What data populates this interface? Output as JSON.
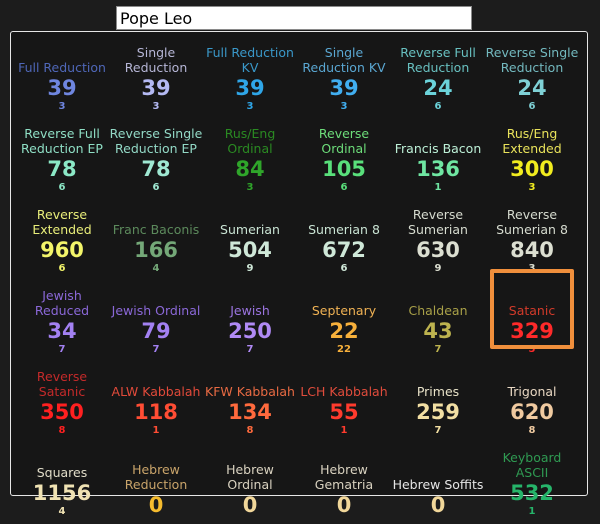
{
  "search": {
    "value": "Pope Leo"
  },
  "cells": [
    {
      "name": "Full Reduction",
      "value": "39",
      "reduced": "3",
      "name_color": "#4f67b8",
      "value_color": "#6f86e0",
      "reduced_color": "#6f86e0"
    },
    {
      "name": "Single Reduction",
      "value": "39",
      "reduced": "3",
      "name_color": "#b6b6d6",
      "value_color": "#b4b9f2",
      "reduced_color": "#b4b9f2"
    },
    {
      "name": "Full Reduction KV",
      "value": "39",
      "reduced": "3",
      "name_color": "#3a98c9",
      "value_color": "#2fa6e8",
      "reduced_color": "#2fa6e8"
    },
    {
      "name": "Single Reduction KV",
      "value": "39",
      "reduced": "3",
      "name_color": "#5aa7d2",
      "value_color": "#41aef0",
      "reduced_color": "#41aef0"
    },
    {
      "name": "Reverse Full Reduction",
      "value": "24",
      "reduced": "6",
      "name_color": "#68c0c0",
      "value_color": "#6bd3da",
      "reduced_color": "#6bd3da"
    },
    {
      "name": "Reverse Single Reduction",
      "value": "24",
      "reduced": "6",
      "name_color": "#73b9bf",
      "value_color": "#7fd1d6",
      "reduced_color": "#7fd1d6"
    },
    {
      "name": "Reverse Full Reduction EP",
      "value": "78",
      "reduced": "6",
      "name_color": "#8fdfc5",
      "value_color": "#8be8c6",
      "reduced_color": "#8be8c6"
    },
    {
      "name": "Reverse Single Reduction EP",
      "value": "78",
      "reduced": "6",
      "name_color": "#93d9c6",
      "value_color": "#9fe8d2",
      "reduced_color": "#9fe8d2"
    },
    {
      "name": "Rus/Eng Ordinal",
      "value": "84",
      "reduced": "3",
      "name_color": "#2a8a22",
      "value_color": "#2fa52a",
      "reduced_color": "#2fa52a"
    },
    {
      "name": "Reverse Ordinal",
      "value": "105",
      "reduced": "6",
      "name_color": "#6ddd7a",
      "value_color": "#59e07b",
      "reduced_color": "#59e07b"
    },
    {
      "name": "Francis Bacon",
      "value": "136",
      "reduced": "1",
      "name_color": "#bdf0d7",
      "value_color": "#6fe6a2",
      "reduced_color": "#6fe6a2"
    },
    {
      "name": "Rus/Eng Extended",
      "value": "300",
      "reduced": "3",
      "name_color": "#e9e35b",
      "value_color": "#f1ec1f",
      "reduced_color": "#f1ec1f"
    },
    {
      "name": "Reverse Extended",
      "value": "960",
      "reduced": "6",
      "name_color": "#e9ee7a",
      "value_color": "#f3f56a",
      "reduced_color": "#f3f56a"
    },
    {
      "name": "Franc Baconis",
      "value": "166",
      "reduced": "4",
      "name_color": "#5c8a5c",
      "value_color": "#74a878",
      "reduced_color": "#74a878"
    },
    {
      "name": "Sumerian",
      "value": "504",
      "reduced": "9",
      "name_color": "#c9e3d3",
      "value_color": "#cfe8d8",
      "reduced_color": "#cfe8d8"
    },
    {
      "name": "Sumerian 8",
      "value": "672",
      "reduced": "6",
      "name_color": "#c9e3d3",
      "value_color": "#cfe8d8",
      "reduced_color": "#cfe8d8"
    },
    {
      "name": "Reverse Sumerian",
      "value": "630",
      "reduced": "9",
      "name_color": "#d6dbcf",
      "value_color": "#dcdfd1",
      "reduced_color": "#dcdfd1"
    },
    {
      "name": "Reverse Sumerian 8",
      "value": "840",
      "reduced": "3",
      "name_color": "#d6dbcf",
      "value_color": "#dcdfd1",
      "reduced_color": "#dcdfd1"
    },
    {
      "name": "Jewish Reduced",
      "value": "34",
      "reduced": "7",
      "name_color": "#8b68d8",
      "value_color": "#a381f2",
      "reduced_color": "#a381f2"
    },
    {
      "name": "Jewish Ordinal",
      "value": "79",
      "reduced": "7",
      "name_color": "#8b68d8",
      "value_color": "#a381f2",
      "reduced_color": "#a381f2"
    },
    {
      "name": "Jewish",
      "value": "250",
      "reduced": "7",
      "name_color": "#9b74e0",
      "value_color": "#b08af5",
      "reduced_color": "#b08af5"
    },
    {
      "name": "Septenary",
      "value": "22",
      "reduced": "22",
      "name_color": "#f0b254",
      "value_color": "#f7b03b",
      "reduced_color": "#f7b03b"
    },
    {
      "name": "Chaldean",
      "value": "43",
      "reduced": "7",
      "name_color": "#a8a048",
      "value_color": "#bdb34f",
      "reduced_color": "#bdb34f"
    },
    {
      "name": "Satanic",
      "value": "329",
      "reduced": "5",
      "name_color": "#d23a2a",
      "value_color": "#ff2a2a",
      "reduced_color": "#ff2a2a"
    },
    {
      "name": "Reverse Satanic",
      "value": "350",
      "reduced": "8",
      "name_color": "#c42a2a",
      "value_color": "#ff2020",
      "reduced_color": "#ff2020"
    },
    {
      "name": "ALW Kabbalah",
      "value": "118",
      "reduced": "1",
      "name_color": "#e14a3a",
      "value_color": "#ff4d34",
      "reduced_color": "#ff4d34"
    },
    {
      "name": "KFW Kabbalah",
      "value": "134",
      "reduced": "8",
      "name_color": "#e86a43",
      "value_color": "#ff6a3d",
      "reduced_color": "#ff6a3d"
    },
    {
      "name": "LCH Kabbalah",
      "value": "55",
      "reduced": "1",
      "name_color": "#e04c3c",
      "value_color": "#ff3b2d",
      "reduced_color": "#ff3b2d"
    },
    {
      "name": "Primes",
      "value": "259",
      "reduced": "7",
      "name_color": "#e8e2c8",
      "value_color": "#f2dfa3",
      "reduced_color": "#f2dfa3"
    },
    {
      "name": "Trigonal",
      "value": "620",
      "reduced": "8",
      "name_color": "#e8d7c2",
      "value_color": "#f0caa0",
      "reduced_color": "#f0caa0"
    },
    {
      "name": "Squares",
      "value": "1156",
      "reduced": "4",
      "name_color": "#e0dcc8",
      "value_color": "#efe2b3",
      "reduced_color": "#efe2b3"
    },
    {
      "name": "Hebrew Reduction",
      "value": "0",
      "reduced": "",
      "name_color": "#c9a46a",
      "value_color": "#f5bb2e",
      "reduced_color": "#f5bb2e"
    },
    {
      "name": "Hebrew Ordinal",
      "value": "0",
      "reduced": "",
      "name_color": "#d9d2c0",
      "value_color": "#f1d79a",
      "reduced_color": "#f1d79a"
    },
    {
      "name": "Hebrew Gematria",
      "value": "0",
      "reduced": "",
      "name_color": "#d9d2c0",
      "value_color": "#f1d79a",
      "reduced_color": "#f1d79a"
    },
    {
      "name": "Hebrew Soffits",
      "value": "0",
      "reduced": "",
      "name_color": "#e6e6e6",
      "value_color": "#f1d79a",
      "reduced_color": "#f1d79a"
    },
    {
      "name": "Keyboard ASCII",
      "value": "532",
      "reduced": "1",
      "name_color": "#2f9a52",
      "value_color": "#26b46a",
      "reduced_color": "#26b46a"
    }
  ]
}
